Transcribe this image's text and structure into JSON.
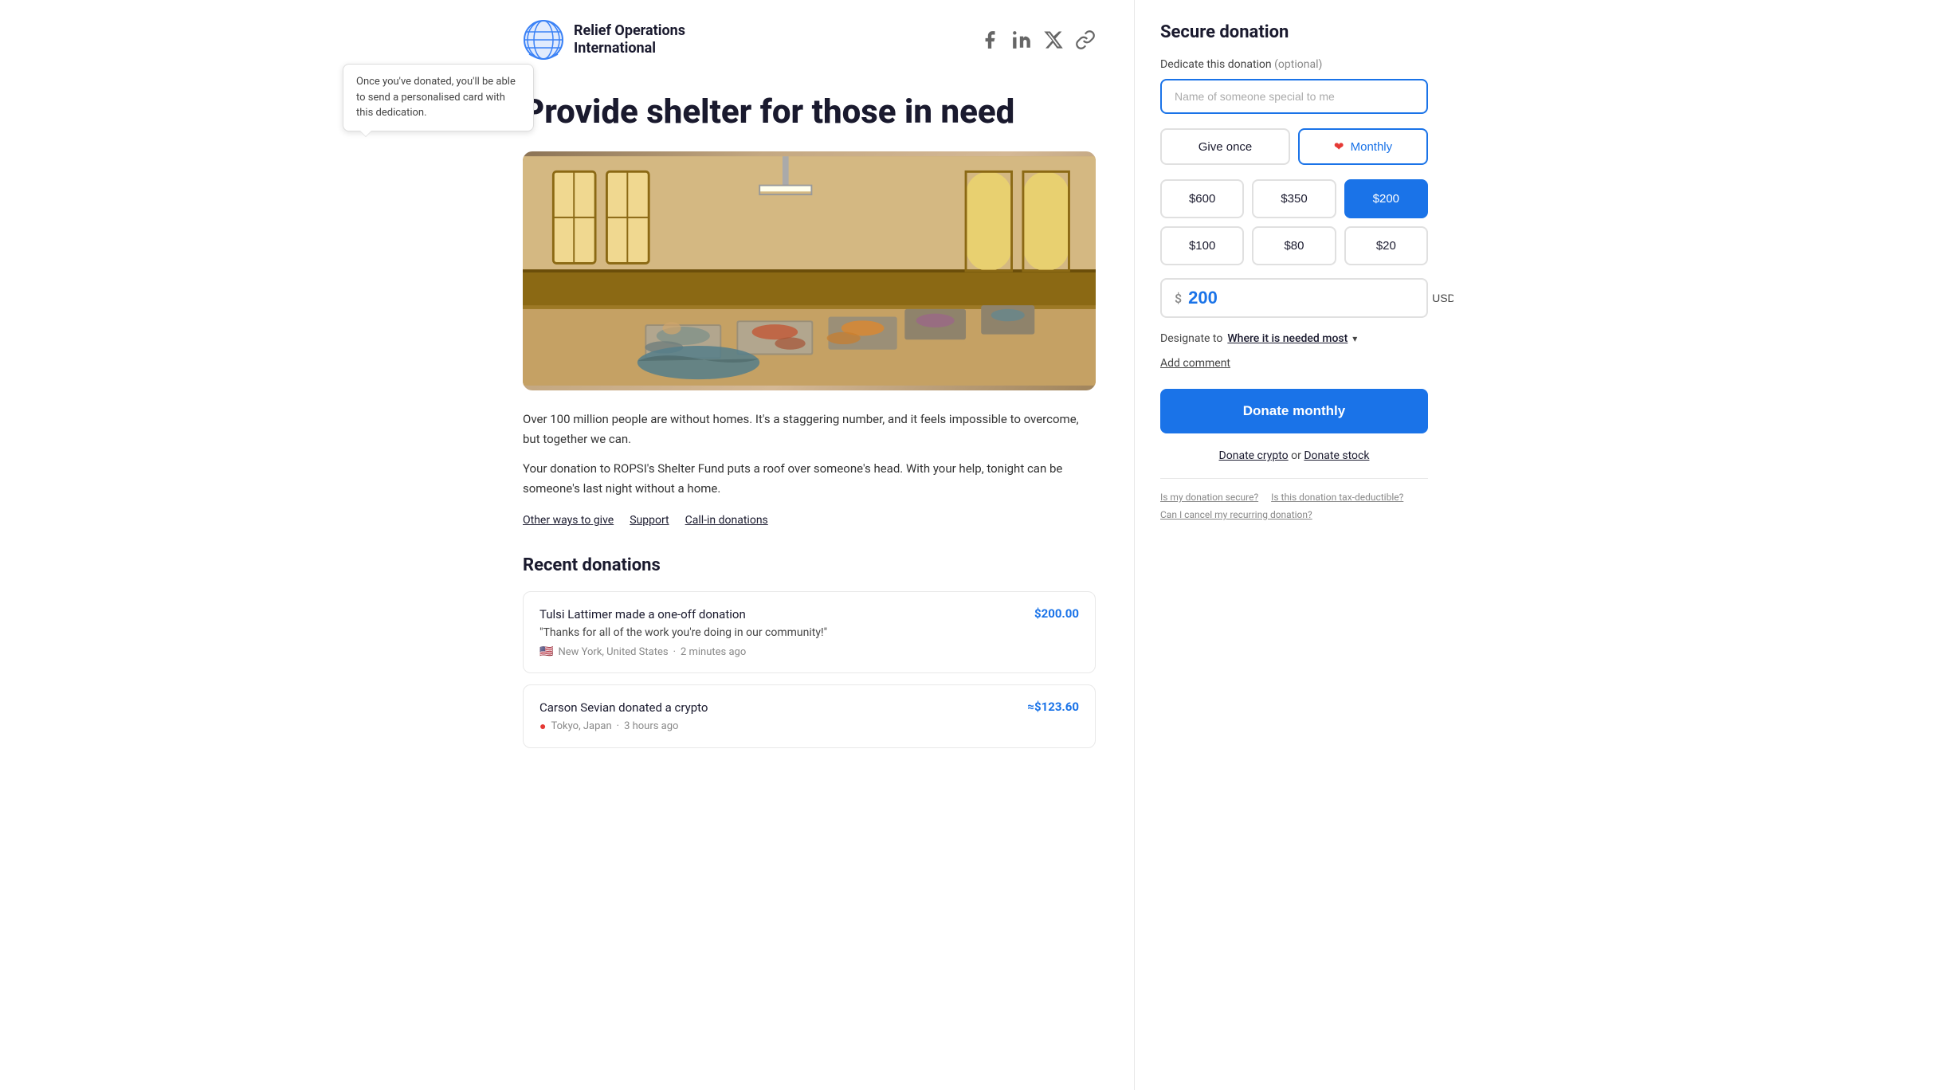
{
  "org": {
    "name_line1": "Relief Operations",
    "name_line2": "International"
  },
  "social": {
    "facebook": "facebook-icon",
    "linkedin": "linkedin-icon",
    "x": "x-icon",
    "link": "link-icon"
  },
  "campaign": {
    "title": "Provide shelter for those in need",
    "description1": "Over 100 million people are without homes. It's a staggering number, and it feels impossible to overcome, but together we can.",
    "description2": "Your donation to ROPSI's Shelter Fund puts a roof over someone's head. With your help, tonight can be someone's last night without a home.",
    "link_other_ways": "Other ways to give",
    "link_support": "Support",
    "link_callin": "Call-in donations"
  },
  "tooltip": {
    "text": "Once you've donated, you'll be able to send a personalised card with this dedication."
  },
  "recent_donations": {
    "title": "Recent donations",
    "items": [
      {
        "name": "Tulsi Lattimer",
        "action": "made a one-off donation",
        "quote": "\"Thanks for all of the work you're doing in our community!\"",
        "flag": "🇺🇸",
        "location": "New York, United States",
        "time": "2 minutes ago",
        "amount": "$200.00"
      },
      {
        "name": "Carson Sevian",
        "action": "donated a crypto",
        "quote": "",
        "flag": "🇯🇵",
        "location": "Tokyo, Japan",
        "time": "3 hours ago",
        "amount": "≈$123.60"
      }
    ]
  },
  "donation_form": {
    "title": "Secure donation",
    "dedicate_label": "Dedicate this donation",
    "dedicate_optional": "(optional)",
    "dedicate_placeholder": "Name of someone special to me",
    "frequency": {
      "give_once": "Give once",
      "monthly": "Monthly",
      "active": "monthly"
    },
    "amounts": [
      {
        "value": "$600",
        "label": "$600",
        "active": false
      },
      {
        "value": "$350",
        "label": "$350",
        "active": false
      },
      {
        "value": "$200",
        "label": "$200",
        "active": true
      },
      {
        "value": "$100",
        "label": "$100",
        "active": false
      },
      {
        "value": "$80",
        "label": "$80",
        "active": false
      },
      {
        "value": "$20",
        "label": "$20",
        "active": false
      }
    ],
    "custom_amount": "200",
    "currency": "USD",
    "designate_label": "Designate to",
    "designate_value": "Where it is needed most",
    "add_comment": "Add comment",
    "donate_button": "Donate monthly",
    "donate_crypto": "Donate crypto",
    "or": "or",
    "donate_stock": "Donate stock",
    "faq": {
      "is_secure": "Is my donation secure?",
      "tax_deductible": "Is this donation tax-deductible?",
      "cancel_recurring": "Can I cancel my recurring donation?"
    }
  }
}
